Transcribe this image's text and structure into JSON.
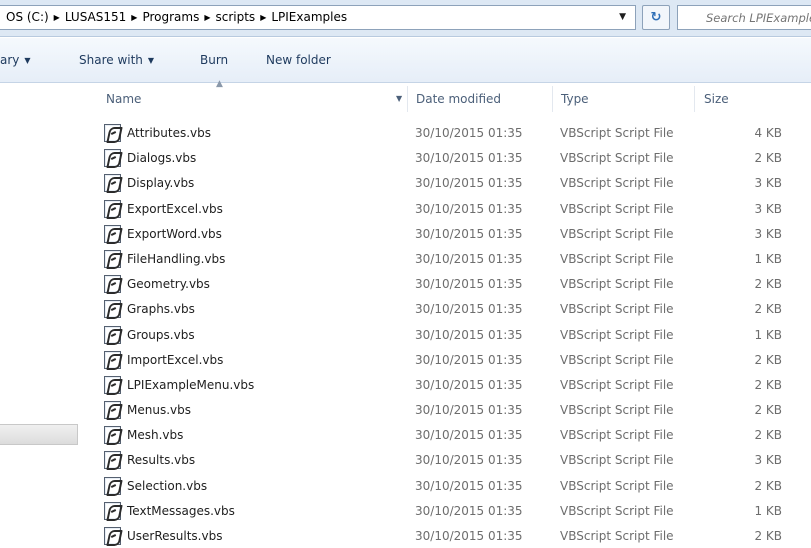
{
  "address": {
    "breadcrumbs": [
      "OS (C:)",
      "LUSAS151",
      "Programs",
      "scripts",
      "LPIExamples"
    ],
    "search_placeholder": "Search LPIExamples"
  },
  "toolbar": {
    "library_label": "ary",
    "share_label": "Share with",
    "burn_label": "Burn",
    "new_folder_label": "New folder"
  },
  "columns": {
    "name": "Name",
    "date": "Date modified",
    "type": "Type",
    "size": "Size"
  },
  "files": [
    {
      "name": "Attributes.vbs",
      "date": "30/10/2015 01:35",
      "type": "VBScript Script File",
      "size": "4 KB"
    },
    {
      "name": "Dialogs.vbs",
      "date": "30/10/2015 01:35",
      "type": "VBScript Script File",
      "size": "2 KB"
    },
    {
      "name": "Display.vbs",
      "date": "30/10/2015 01:35",
      "type": "VBScript Script File",
      "size": "3 KB"
    },
    {
      "name": "ExportExcel.vbs",
      "date": "30/10/2015 01:35",
      "type": "VBScript Script File",
      "size": "3 KB"
    },
    {
      "name": "ExportWord.vbs",
      "date": "30/10/2015 01:35",
      "type": "VBScript Script File",
      "size": "3 KB"
    },
    {
      "name": "FileHandling.vbs",
      "date": "30/10/2015 01:35",
      "type": "VBScript Script File",
      "size": "1 KB"
    },
    {
      "name": "Geometry.vbs",
      "date": "30/10/2015 01:35",
      "type": "VBScript Script File",
      "size": "2 KB"
    },
    {
      "name": "Graphs.vbs",
      "date": "30/10/2015 01:35",
      "type": "VBScript Script File",
      "size": "2 KB"
    },
    {
      "name": "Groups.vbs",
      "date": "30/10/2015 01:35",
      "type": "VBScript Script File",
      "size": "1 KB"
    },
    {
      "name": "ImportExcel.vbs",
      "date": "30/10/2015 01:35",
      "type": "VBScript Script File",
      "size": "2 KB"
    },
    {
      "name": "LPIExampleMenu.vbs",
      "date": "30/10/2015 01:35",
      "type": "VBScript Script File",
      "size": "2 KB"
    },
    {
      "name": "Menus.vbs",
      "date": "30/10/2015 01:35",
      "type": "VBScript Script File",
      "size": "2 KB"
    },
    {
      "name": "Mesh.vbs",
      "date": "30/10/2015 01:35",
      "type": "VBScript Script File",
      "size": "2 KB"
    },
    {
      "name": "Results.vbs",
      "date": "30/10/2015 01:35",
      "type": "VBScript Script File",
      "size": "3 KB"
    },
    {
      "name": "Selection.vbs",
      "date": "30/10/2015 01:35",
      "type": "VBScript Script File",
      "size": "2 KB"
    },
    {
      "name": "TextMessages.vbs",
      "date": "30/10/2015 01:35",
      "type": "VBScript Script File",
      "size": "1 KB"
    },
    {
      "name": "UserResults.vbs",
      "date": "30/10/2015 01:35",
      "type": "VBScript Script File",
      "size": "2 KB"
    }
  ]
}
